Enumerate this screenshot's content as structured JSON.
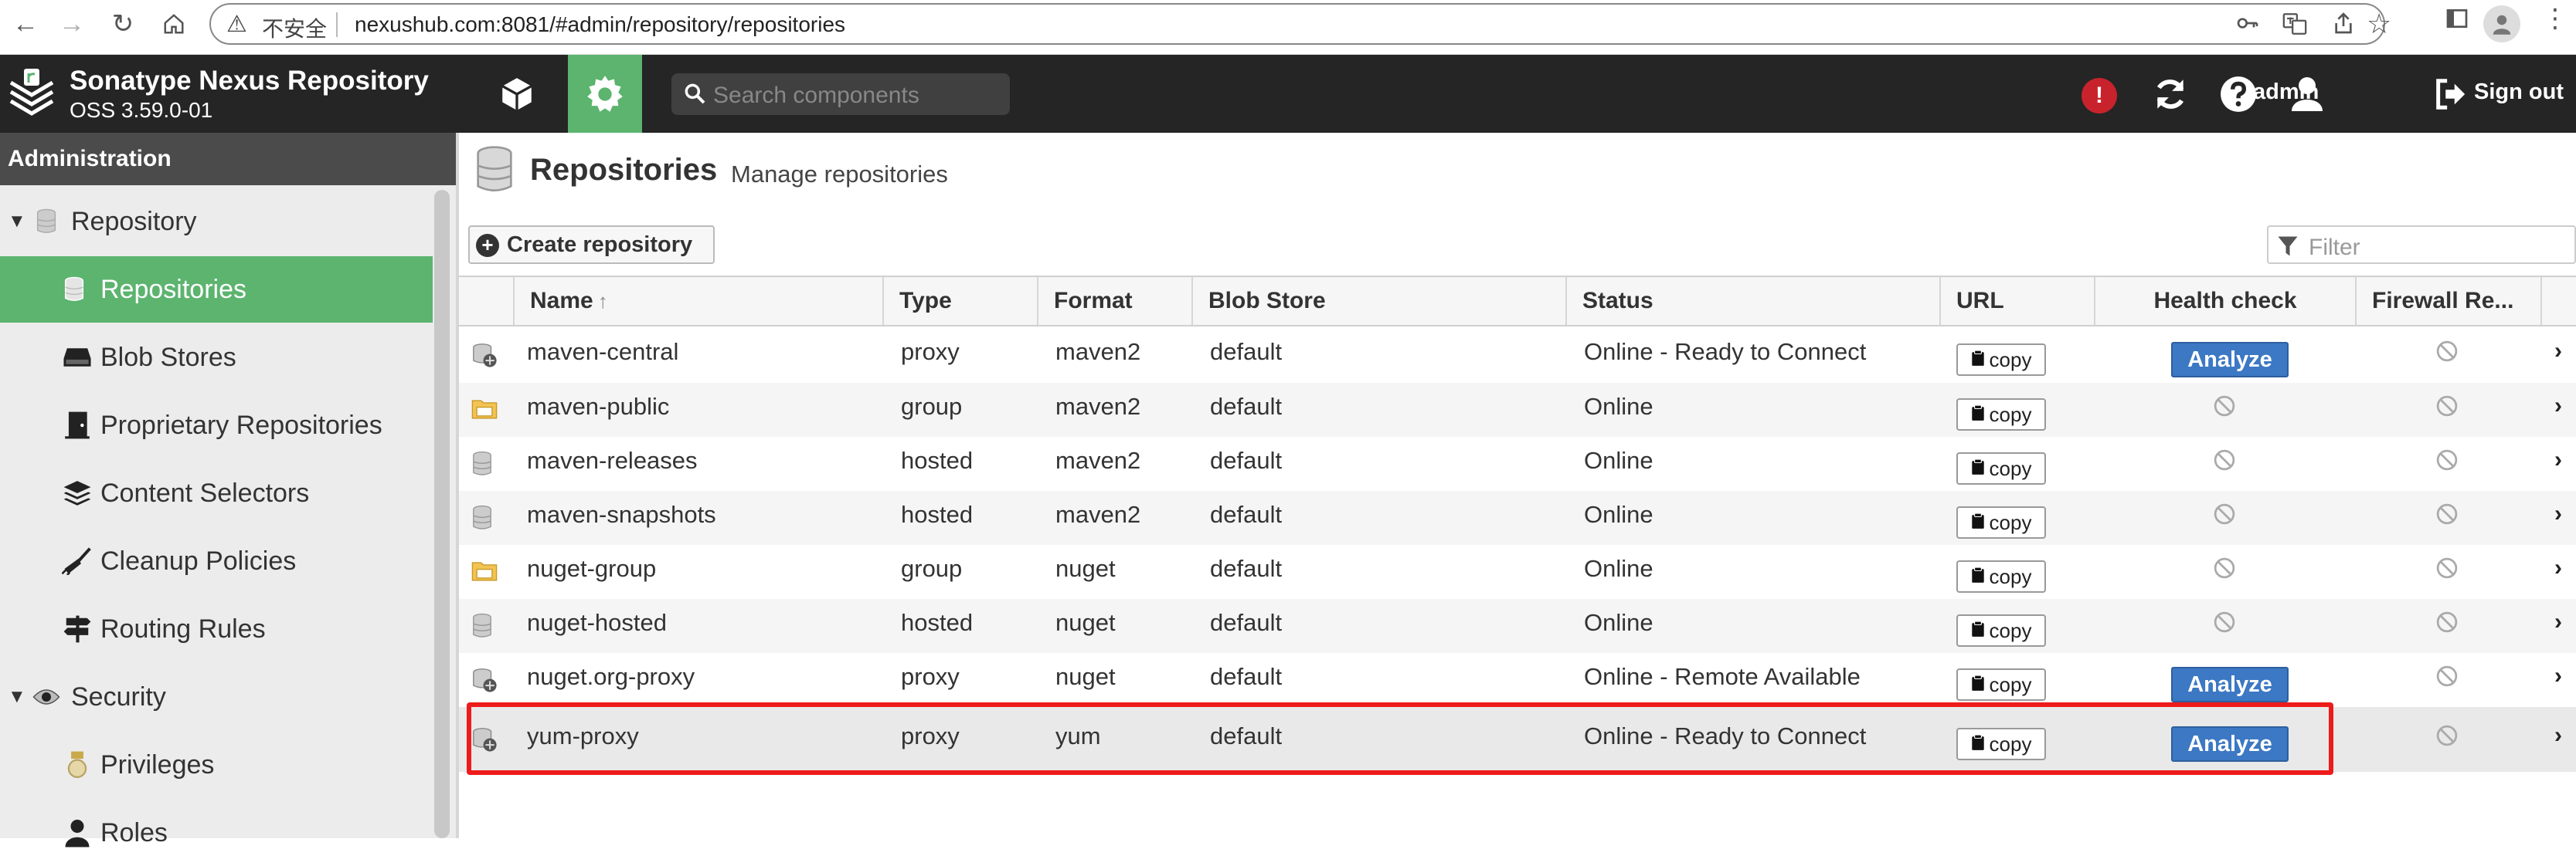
{
  "browser": {
    "insecure_label": "不安全",
    "url": "nexushub.com:8081/#admin/repository/repositories"
  },
  "app": {
    "name": "Sonatype Nexus Repository",
    "version": "OSS 3.59.0-01",
    "search_placeholder": "Search components",
    "alert_glyph": "!",
    "user": "admin",
    "signout": "Sign out"
  },
  "sidebar": {
    "title": "Administration",
    "items": [
      {
        "label": "Repository",
        "icon": "database-icon",
        "level": 0,
        "expanded": true
      },
      {
        "label": "Repositories",
        "icon": "database-icon",
        "level": 1,
        "selected": true
      },
      {
        "label": "Blob Stores",
        "icon": "hard-drive-icon",
        "level": 1
      },
      {
        "label": "Proprietary Repositories",
        "icon": "door-icon",
        "level": 1
      },
      {
        "label": "Content Selectors",
        "icon": "layers-icon",
        "level": 1
      },
      {
        "label": "Cleanup Policies",
        "icon": "broom-icon",
        "level": 1
      },
      {
        "label": "Routing Rules",
        "icon": "signpost-icon",
        "level": 1
      },
      {
        "label": "Security",
        "icon": "eye-icon",
        "level": 0,
        "expanded": true
      },
      {
        "label": "Privileges",
        "icon": "medal-icon",
        "level": 1
      },
      {
        "label": "Roles",
        "icon": "user-icon",
        "level": 1
      }
    ]
  },
  "page": {
    "title": "Repositories",
    "subtitle": "Manage repositories",
    "create_label": "Create repository",
    "filter_placeholder": "Filter"
  },
  "table": {
    "columns": [
      "Name",
      "Type",
      "Format",
      "Blob Store",
      "Status",
      "URL",
      "Health check",
      "Firewall Re..."
    ],
    "sort_indicator": "↑",
    "copy_label": "copy",
    "analyze_label": "Analyze",
    "rows": [
      {
        "name": "maven-central",
        "type": "proxy",
        "format": "maven2",
        "blob": "default",
        "status": "Online - Ready to Connect",
        "health": "analyze"
      },
      {
        "name": "maven-public",
        "type": "group",
        "format": "maven2",
        "blob": "default",
        "status": "Online",
        "health": "none"
      },
      {
        "name": "maven-releases",
        "type": "hosted",
        "format": "maven2",
        "blob": "default",
        "status": "Online",
        "health": "none"
      },
      {
        "name": "maven-snapshots",
        "type": "hosted",
        "format": "maven2",
        "blob": "default",
        "status": "Online",
        "health": "none"
      },
      {
        "name": "nuget-group",
        "type": "group",
        "format": "nuget",
        "blob": "default",
        "status": "Online",
        "health": "none"
      },
      {
        "name": "nuget-hosted",
        "type": "hosted",
        "format": "nuget",
        "blob": "default",
        "status": "Online",
        "health": "none"
      },
      {
        "name": "nuget.org-proxy",
        "type": "proxy",
        "format": "nuget",
        "blob": "default",
        "status": "Online - Remote Available",
        "health": "analyze"
      },
      {
        "name": "yum-proxy",
        "type": "proxy",
        "format": "yum",
        "blob": "default",
        "status": "Online - Ready to Connect",
        "health": "analyze",
        "selected": true
      }
    ]
  },
  "colors": {
    "accent": "#5cb46f",
    "header_bg": "#252525",
    "analyze": "#3c78c3",
    "highlight": "#ee1b1b"
  }
}
